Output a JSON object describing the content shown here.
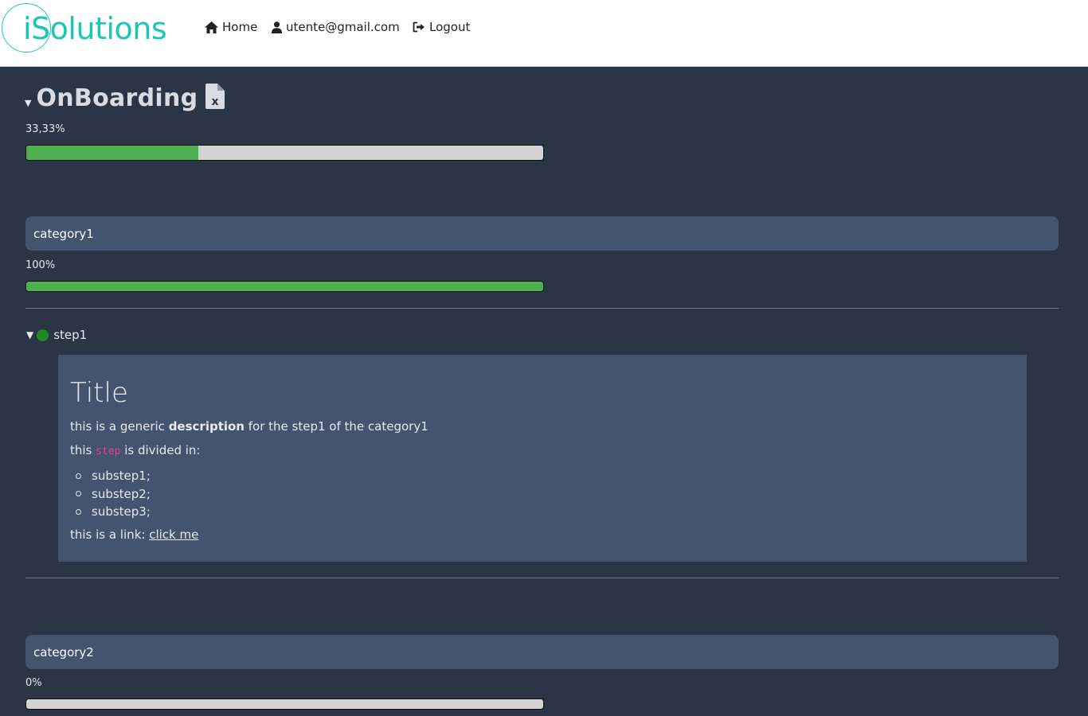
{
  "header": {
    "logo": "iSolutions",
    "nav": {
      "home": "Home",
      "user": "utente@gmail.com",
      "logout": "Logout"
    }
  },
  "onboarding": {
    "title": "OnBoarding",
    "progress_label": "33,33%",
    "progress_fraction": 0.3333
  },
  "categories": [
    {
      "name": "category1",
      "progress_label": "100%",
      "progress_fraction": 1.0,
      "steps": [
        {
          "name": "step1",
          "status_color": "#1f8a1f",
          "content": {
            "title": "Title",
            "desc_prefix": "this is a generic ",
            "desc_bold": "description",
            "desc_suffix": " for the step1 of the category1",
            "divided_prefix": "this ",
            "divided_code": "step",
            "divided_suffix": " is divided in:",
            "substeps": [
              "substep1;",
              "substep2;",
              "substep3;"
            ],
            "link_prefix": "this is a link: ",
            "link_text": "click me"
          }
        }
      ]
    },
    {
      "name": "category2",
      "progress_label": "0%",
      "progress_fraction": 0.0
    }
  ],
  "colors": {
    "background": "#2a3546",
    "panel": "#44546e",
    "progress_fill": "#4caf50",
    "brand": "#1cc7b6",
    "code": "#e83e8c"
  }
}
